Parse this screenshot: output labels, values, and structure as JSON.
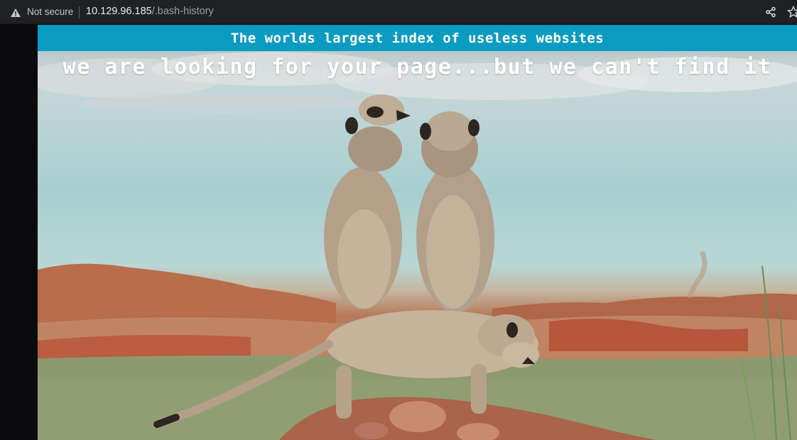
{
  "browser": {
    "security_label": "Not secure",
    "url_host": "10.129.96.185",
    "url_path": "/.bash-history",
    "icons": [
      "warning-icon",
      "share-icon",
      "star-icon"
    ]
  },
  "page": {
    "banner_text": "The worlds largest index of useless websites",
    "headline": "we are looking for your page...but we can't find it",
    "banner_color": "#0a9bc1"
  }
}
